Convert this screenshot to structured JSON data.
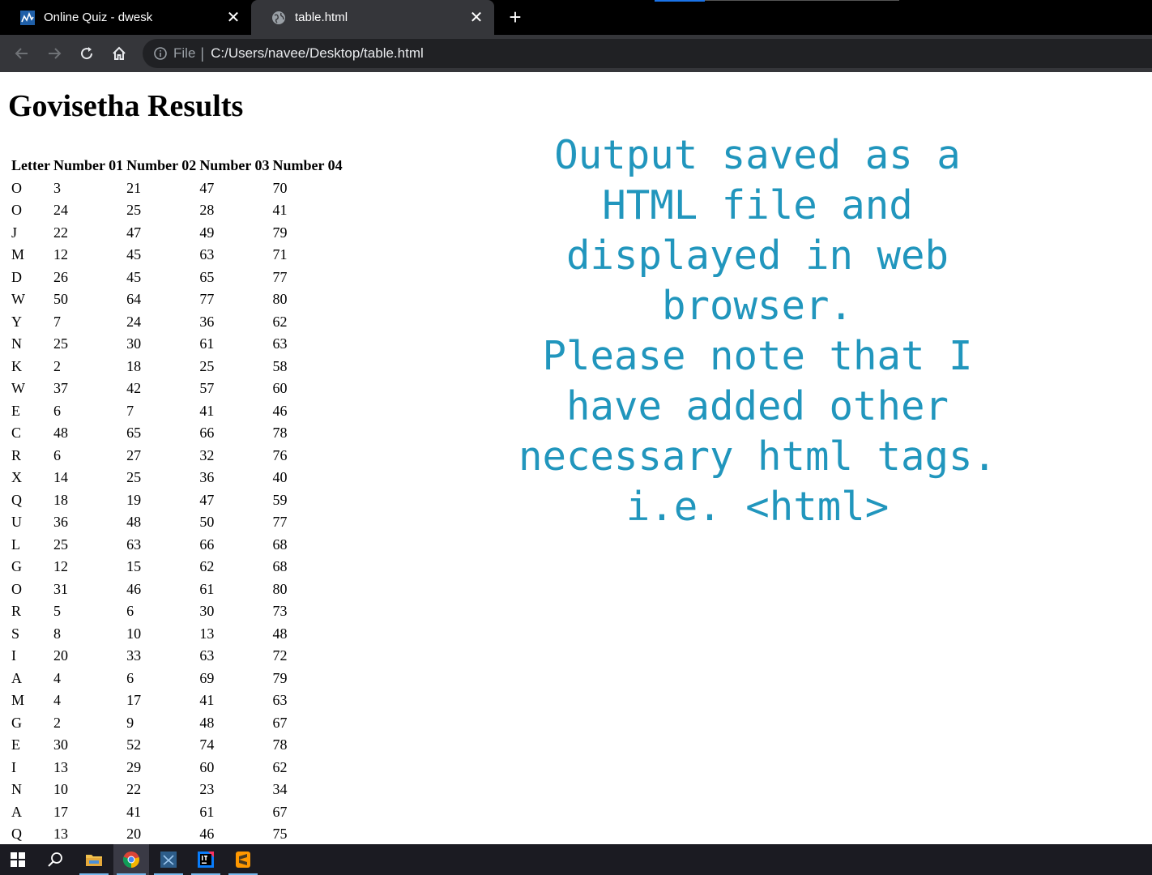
{
  "browser": {
    "tabs": [
      {
        "title": "Online Quiz - dwesk",
        "favicon": "dwesk-logo-icon",
        "active": false
      },
      {
        "title": "table.html",
        "favicon": "globe-icon",
        "active": true
      }
    ],
    "address": {
      "scheme_label": "File",
      "separator": "|",
      "url": "C:/Users/navee/Desktop/table.html"
    }
  },
  "page": {
    "heading": "Govisetha Results",
    "table": {
      "headers": [
        "Letter",
        "Number 01",
        "Number 02",
        "Number 03",
        "Number 04"
      ],
      "rows": [
        [
          "O",
          "3",
          "21",
          "47",
          "70"
        ],
        [
          "O",
          "24",
          "25",
          "28",
          "41"
        ],
        [
          "J",
          "22",
          "47",
          "49",
          "79"
        ],
        [
          "M",
          "12",
          "45",
          "63",
          "71"
        ],
        [
          "D",
          "26",
          "45",
          "65",
          "77"
        ],
        [
          "W",
          "50",
          "64",
          "77",
          "80"
        ],
        [
          "Y",
          "7",
          "24",
          "36",
          "62"
        ],
        [
          "N",
          "25",
          "30",
          "61",
          "63"
        ],
        [
          "K",
          "2",
          "18",
          "25",
          "58"
        ],
        [
          "W",
          "37",
          "42",
          "57",
          "60"
        ],
        [
          "E",
          "6",
          "7",
          "41",
          "46"
        ],
        [
          "C",
          "48",
          "65",
          "66",
          "78"
        ],
        [
          "R",
          "6",
          "27",
          "32",
          "76"
        ],
        [
          "X",
          "14",
          "25",
          "36",
          "40"
        ],
        [
          "Q",
          "18",
          "19",
          "47",
          "59"
        ],
        [
          "U",
          "36",
          "48",
          "50",
          "77"
        ],
        [
          "L",
          "25",
          "63",
          "66",
          "68"
        ],
        [
          "G",
          "12",
          "15",
          "62",
          "68"
        ],
        [
          "O",
          "31",
          "46",
          "61",
          "80"
        ],
        [
          "R",
          "5",
          "6",
          "30",
          "73"
        ],
        [
          "S",
          "8",
          "10",
          "13",
          "48"
        ],
        [
          "I",
          "20",
          "33",
          "63",
          "72"
        ],
        [
          "A",
          "4",
          "6",
          "69",
          "79"
        ],
        [
          "M",
          "4",
          "17",
          "41",
          "63"
        ],
        [
          "G",
          "2",
          "9",
          "48",
          "67"
        ],
        [
          "E",
          "30",
          "52",
          "74",
          "78"
        ],
        [
          "I",
          "13",
          "29",
          "60",
          "62"
        ],
        [
          "N",
          "10",
          "22",
          "23",
          "34"
        ],
        [
          "A",
          "17",
          "41",
          "61",
          "67"
        ],
        [
          "Q",
          "13",
          "20",
          "46",
          "75"
        ]
      ]
    },
    "note_lines": [
      "Output saved as a",
      "HTML file and",
      "displayed in web",
      "browser.",
      "Please note that I",
      "have added other",
      "necessary html tags.",
      "i.e. <html>"
    ]
  },
  "colors": {
    "note_text": "#2196bd",
    "tab_strip": "#000000",
    "toolbar": "#35363a",
    "taskbar": "#1b1b22"
  },
  "taskbar": {
    "items": [
      "windows-start-icon",
      "search-icon",
      "file-explorer-icon",
      "chrome-icon",
      "visual-studio-icon",
      "intellij-icon",
      "sublime-text-icon"
    ]
  }
}
